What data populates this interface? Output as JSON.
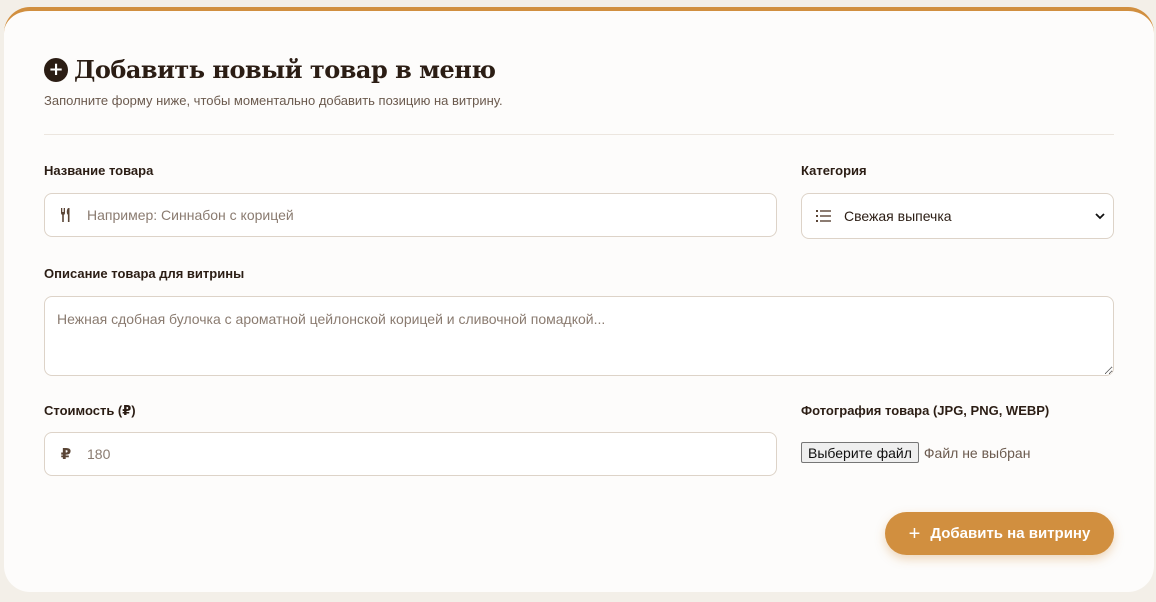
{
  "header": {
    "title": "Добавить новый товар в меню",
    "subtitle": "Заполните форму ниже, чтобы моментально добавить позицию на витрину."
  },
  "fields": {
    "name": {
      "label": "Название товара",
      "placeholder": "Например: Синнабон с корицей",
      "icon": "fork-knife-icon"
    },
    "category": {
      "label": "Категория",
      "value": "Свежая выпечка",
      "icon": "list-icon"
    },
    "description": {
      "label": "Описание товара для витрины",
      "placeholder": "Нежная сдобная булочка с ароматной цейлонской корицей и сливочной помадкой..."
    },
    "price": {
      "label": "Стоимость (₽)",
      "placeholder": "180",
      "icon": "ruble-icon",
      "icon_glyph": "₽"
    },
    "photo": {
      "label": "Фотография товара (JPG, PNG, WEBP)",
      "button_label": "Выберите файл",
      "status": "Файл не выбран"
    }
  },
  "submit": {
    "label": "Добавить на витрину"
  },
  "colors": {
    "accent": "#d18f3f",
    "text": "#2b1d14",
    "muted": "#6b5a4e",
    "border": "#ddd3c8",
    "background": "#f3efe8"
  }
}
